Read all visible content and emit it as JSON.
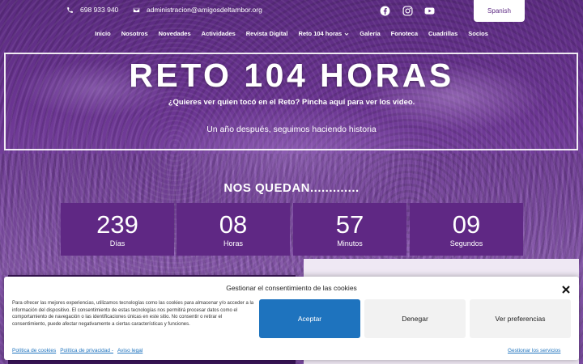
{
  "topbar": {
    "phone": "698 933 940",
    "email": "administracion@amigosdeltambor.org",
    "social": [
      "facebook-icon",
      "instagram-icon",
      "youtube-icon"
    ],
    "language": "Spanish"
  },
  "nav": {
    "items": [
      "Inicio",
      "Nosotros",
      "Novedades",
      "Actividades",
      "Revista Digital",
      "Reto 104 horas",
      "Galería",
      "Fonoteca",
      "Cuadrillas",
      "Socios"
    ]
  },
  "hero": {
    "title": "RETO 104 HORAS",
    "subtitle": "¿Quieres ver quien tocó en el Reto? Pincha aquí para ver los video.",
    "tagline": "Un año después, seguimos haciendo historia"
  },
  "countdown": {
    "heading": "NOS QUEDAN.............",
    "units": [
      {
        "value": "239",
        "label": "Días"
      },
      {
        "value": "08",
        "label": "Horas"
      },
      {
        "value": "57",
        "label": "Minutos"
      },
      {
        "value": "09",
        "label": "Segundos"
      }
    ]
  },
  "cookie": {
    "title": "Gestionar el consentimiento de las cookies",
    "text": "Para ofrecer las mejores experiencias, utilizamos tecnologías como las cookies para almacenar y/o acceder a la información del dispositivo. El consentimiento de estas tecnologías nos permitirá procesar datos como el comportamiento de navegación o las identificaciones únicas en este sitio. No consentir o retirar el consentimiento, puede afectar negativamente a ciertas características y funciones.",
    "accept": "Aceptar",
    "deny": "Denegar",
    "preferences": "Ver preferencias",
    "links": [
      "Política de cookies",
      "Política de privacidad -",
      "Aviso legal"
    ],
    "manage": "Gestionar los servicios"
  },
  "colors": {
    "brand": "#5e2a84",
    "accept": "#1e73be"
  }
}
